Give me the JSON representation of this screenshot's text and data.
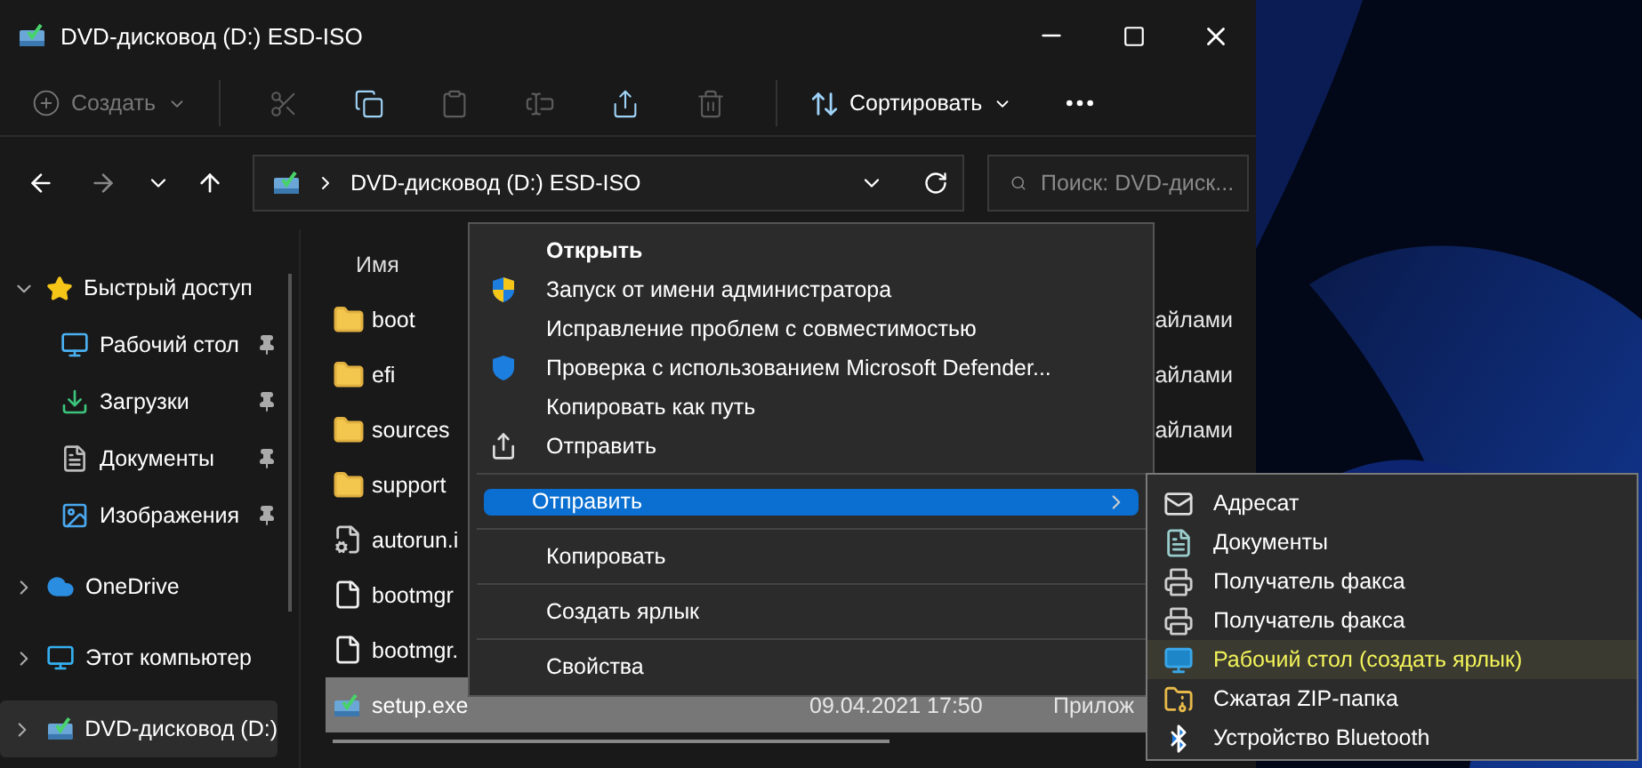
{
  "window": {
    "title": "DVD-дисковод (D:) ESD-ISO"
  },
  "toolbar": {
    "new": {
      "label": "Создать",
      "disabled": true
    },
    "tools": [
      {
        "disabled": true
      },
      {
        "disabled": false
      },
      {
        "disabled": true
      },
      {
        "disabled": true
      },
      {
        "disabled": false
      },
      {
        "disabled": true
      }
    ],
    "sort": {
      "label": "Сортировать"
    }
  },
  "address": {
    "path": "DVD-дисковод (D:) ESD-ISO"
  },
  "search": {
    "placeholder": "Поиск: DVD-диск..."
  },
  "sidebar": {
    "items": [
      {
        "label": "Быстрый доступ",
        "expanded": true,
        "selected": false,
        "children": [
          {
            "label": "Рабочий стол",
            "pinned": true,
            "selected": false
          },
          {
            "label": "Загрузки",
            "pinned": true,
            "selected": false
          },
          {
            "label": "Документы",
            "pinned": true,
            "selected": false
          },
          {
            "label": "Изображения",
            "pinned": true,
            "selected": false
          }
        ]
      },
      {
        "label": "OneDrive",
        "expanded": false,
        "selected": false
      },
      {
        "label": "Этот компьютер",
        "expanded": false,
        "selected": false
      },
      {
        "label": "DVD-дисковод (D:)",
        "expanded": false,
        "selected": true
      }
    ]
  },
  "file_list": {
    "columns": [
      {
        "label": "Имя"
      }
    ],
    "rows": [
      {
        "kind": "folder",
        "name": "boot",
        "type": "айлами",
        "selected": false
      },
      {
        "kind": "folder",
        "name": "efi",
        "type": "айлами",
        "selected": false
      },
      {
        "kind": "folder",
        "name": "sources",
        "type": "айлами",
        "selected": false
      },
      {
        "kind": "folder",
        "name": "support",
        "selected": false
      },
      {
        "kind": "settings",
        "name": "autorun.i",
        "selected": false
      },
      {
        "kind": "file",
        "name": "bootmgr",
        "selected": false
      },
      {
        "kind": "file",
        "name": "bootmgr.",
        "selected": false
      },
      {
        "kind": "app",
        "name": "setup.exe",
        "date": "09.04.2021 17:50",
        "type": "Прилож",
        "selected": true
      }
    ]
  },
  "context_menu": {
    "items": [
      {
        "kind": "default",
        "label": "Открыть",
        "selected": false
      },
      {
        "kind": "item",
        "label": "Запуск от имени администратора",
        "selected": false
      },
      {
        "kind": "item",
        "label": "Исправление проблем с совместимостью",
        "selected": false
      },
      {
        "kind": "item",
        "label": "Проверка с использованием Microsoft Defender...",
        "selected": false
      },
      {
        "kind": "item",
        "label": "Копировать как путь",
        "selected": false
      },
      {
        "kind": "item",
        "label": "Отправить",
        "selected": false
      },
      {
        "kind": "separator"
      },
      {
        "kind": "submenu",
        "label": "Отправить",
        "selected": true
      },
      {
        "kind": "separator"
      },
      {
        "kind": "item",
        "label": "Копировать",
        "selected": false
      },
      {
        "kind": "separator"
      },
      {
        "kind": "item",
        "label": "Создать ярлык",
        "selected": false
      },
      {
        "kind": "separator"
      },
      {
        "kind": "item",
        "label": "Свойства",
        "selected": false
      }
    ]
  },
  "send_to_menu": {
    "items": [
      {
        "label": "Адресат",
        "selected": false
      },
      {
        "label": "Документы",
        "selected": false
      },
      {
        "label": "Получатель факса",
        "selected": false
      },
      {
        "label": "Получатель факса",
        "selected": false
      },
      {
        "label": "Рабочий стол (создать ярлык)",
        "selected": true
      },
      {
        "label": "Сжатая ZIP-папка",
        "selected": false
      },
      {
        "label": "Устройство Bluetooth",
        "selected": false
      }
    ]
  }
}
